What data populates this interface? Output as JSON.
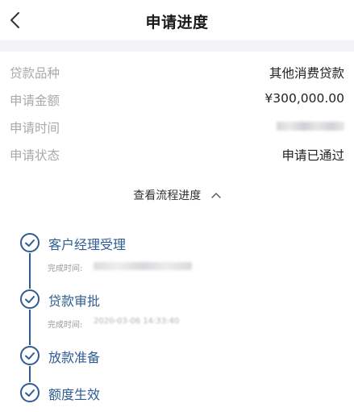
{
  "header": {
    "title": "申请进度"
  },
  "info": {
    "rows": [
      {
        "label": "贷款品种",
        "value": "其他消费贷款"
      },
      {
        "label": "申请金额",
        "value": "¥300,000.00"
      },
      {
        "label": "申请时间",
        "value": ""
      },
      {
        "label": "申请状态",
        "value": "申请已通过"
      }
    ]
  },
  "toggle": {
    "label": "查看流程进度"
  },
  "timeline": {
    "accent_color": "#2f5c93",
    "steps": [
      {
        "title": "客户经理受理",
        "time_label": "完成时间:",
        "time_value": ""
      },
      {
        "title": "贷款审批",
        "time_label": "完成时间:",
        "time_value": "2020-03-06 14:33:40"
      },
      {
        "title": "放款准备"
      },
      {
        "title": "额度生效"
      }
    ]
  }
}
